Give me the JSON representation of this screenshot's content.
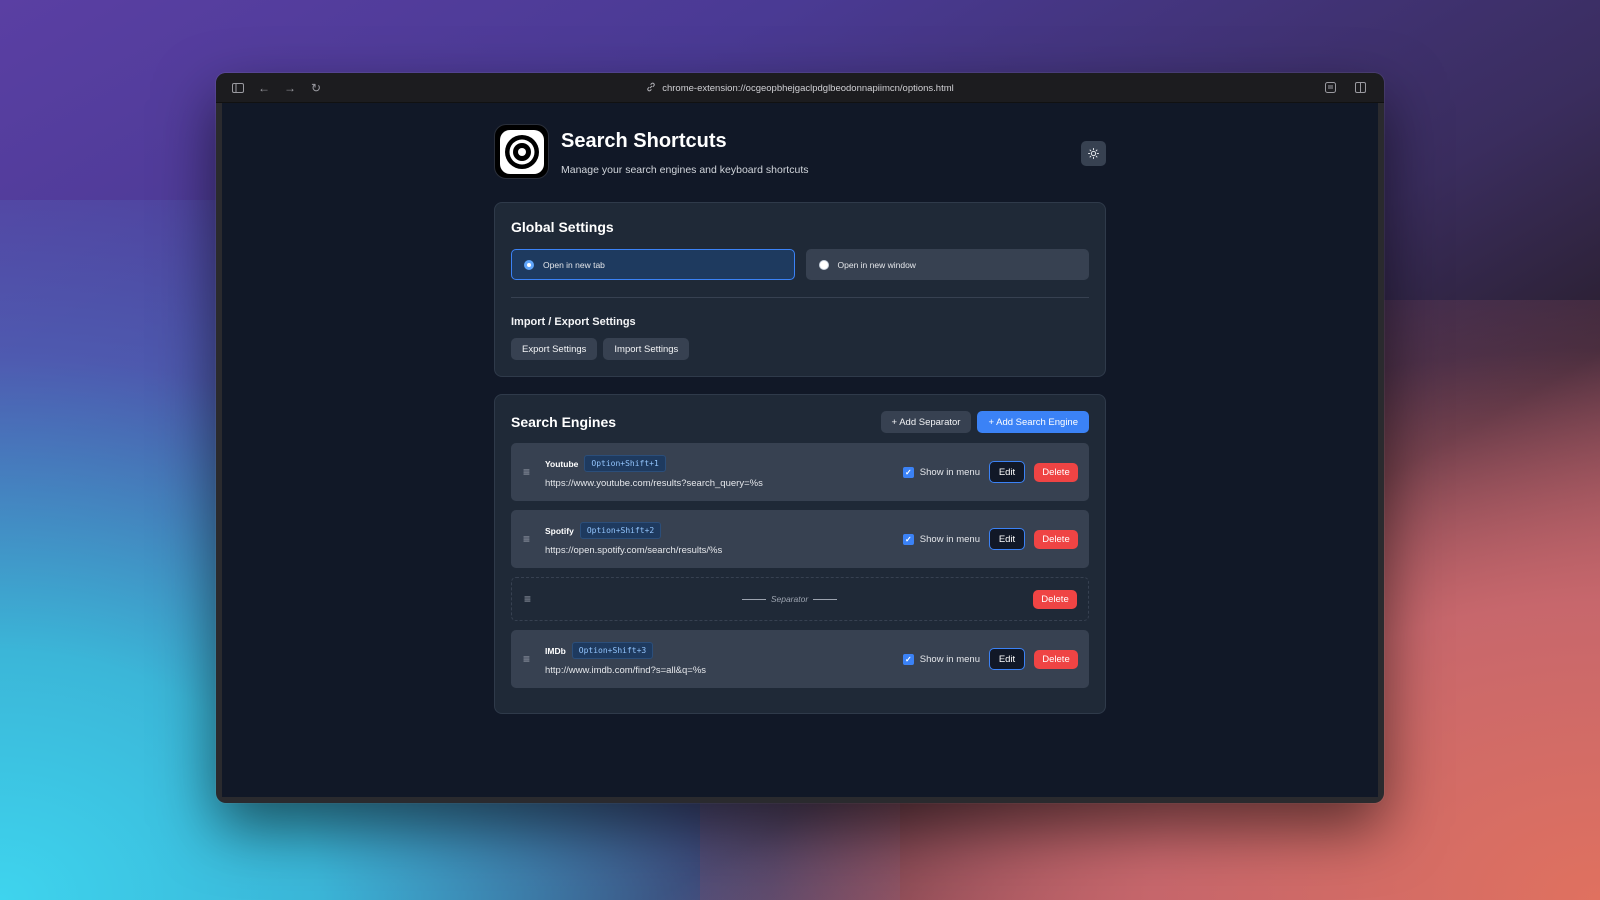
{
  "browser": {
    "url": "chrome-extension://ocgeopbhejgaclpdglbeodonnapiimcn/options.html"
  },
  "header": {
    "title": "Search Shortcuts",
    "subtitle": "Manage your search engines and keyboard shortcuts"
  },
  "global": {
    "title": "Global Settings",
    "options": [
      {
        "label": "Open in new tab",
        "selected": true
      },
      {
        "label": "Open in new window",
        "selected": false
      }
    ],
    "import_export_label": "Import / Export Settings",
    "export_label": "Export Settings",
    "import_label": "Import Settings"
  },
  "engines": {
    "title": "Search Engines",
    "add_separator_label": "+ Add Separator",
    "add_engine_label": "+ Add Search Engine",
    "show_label": "Show in menu",
    "edit_label": "Edit",
    "delete_label": "Delete",
    "separator_label": "Separator",
    "items": [
      {
        "name": "Youtube",
        "shortcut": "Option+Shift+1",
        "url": "https://www.youtube.com/results?search_query=%s",
        "show": true
      },
      {
        "name": "Spotify",
        "shortcut": "Option+Shift+2",
        "url": "https://open.spotify.com/search/results/%s",
        "show": true
      },
      {
        "name": "IMDb",
        "shortcut": "Option+Shift+3",
        "url": "http://www.imdb.com/find?s=all&q=%s",
        "show": true
      }
    ]
  },
  "colors": {
    "accent": "#3b82f6",
    "danger": "#ef4444",
    "page_bg": "#111827",
    "card_bg": "#1f2937"
  }
}
